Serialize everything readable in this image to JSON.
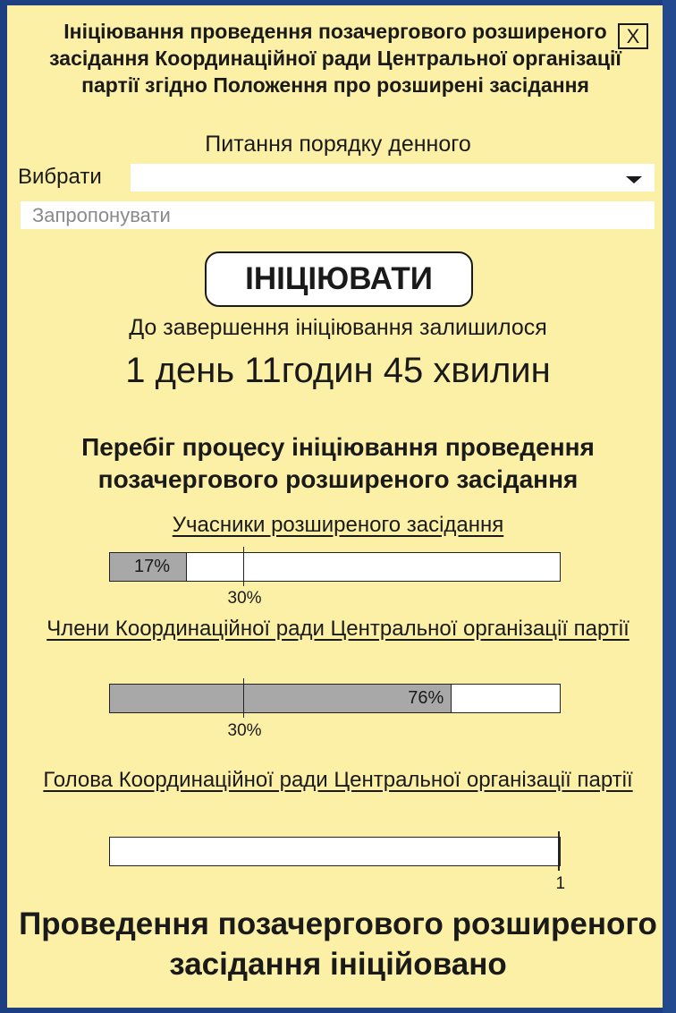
{
  "dialog": {
    "title": "Ініціювання проведення позачергового розширеного засідання Координаційної ради Центральної організації партії згідно Положення про розширені засідання",
    "close_label": "X",
    "agenda_label": "Питання порядку денного",
    "select_label": "Вибрати",
    "select_value": "",
    "propose_placeholder": "Запропонувати",
    "initiate_button": "ІНІЦІЮВАТИ",
    "remaining_label": "До завершення ініціювання залишилося",
    "remaining_time": "1 день 11годин 45 хвилин",
    "progress_title": "Перебіг процесу ініціювання проведення позачергового розширеного засідання",
    "result_text": "Проведення позачергового розширеного засідання ініційовано"
  },
  "groups": [
    {
      "label": "Учасники розширеного засідання",
      "value_label": "17%",
      "value": 17,
      "threshold_label": "30%",
      "threshold": 30
    },
    {
      "label": "Члени Координаційної ради Центральної організації партії",
      "value_label": "76%",
      "value": 76,
      "threshold_label": "30%",
      "threshold": 30
    },
    {
      "label": "Голова Координаційної ради Центральної організації партії",
      "value_label": "",
      "value": 0,
      "threshold_label": "1",
      "threshold": 100
    }
  ],
  "colors": {
    "background": "#fcf0a6",
    "bar_fill": "#a8a8a8",
    "frame": "#1d3f82"
  }
}
